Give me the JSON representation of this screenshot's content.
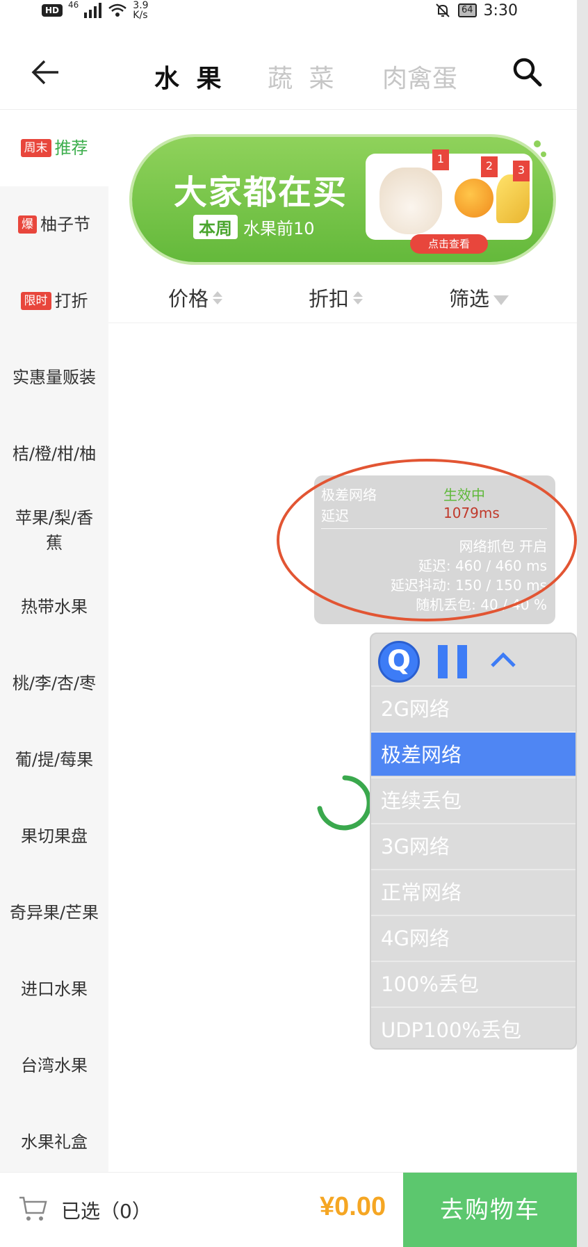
{
  "status_bar": {
    "hd_badge": "HD",
    "network": "46",
    "speed_value": "3.9",
    "speed_unit": "K/s",
    "battery": "64",
    "time": "3:30"
  },
  "header": {
    "tabs": [
      {
        "label": "水 果",
        "active": true
      },
      {
        "label": "蔬 菜",
        "active": false
      },
      {
        "label": "肉禽蛋",
        "active": false
      }
    ]
  },
  "sidebar": {
    "items": [
      {
        "tag": "周末",
        "label": "推荐"
      },
      {
        "tag": "爆",
        "label": "柚子节"
      },
      {
        "tag": "限时",
        "label": "打折"
      },
      {
        "label": "实惠量贩装"
      },
      {
        "label": "桔/橙/柑/柚"
      },
      {
        "label": "苹果/梨/香蕉"
      },
      {
        "label": "热带水果"
      },
      {
        "label": "桃/李/杏/枣"
      },
      {
        "label": "葡/提/莓果"
      },
      {
        "label": "果切果盘"
      },
      {
        "label": "奇异果/芒果"
      },
      {
        "label": "进口水果"
      },
      {
        "label": "台湾水果"
      },
      {
        "label": "水果礼盒"
      }
    ]
  },
  "banner": {
    "title": "大家都在买",
    "badge": "本周",
    "subtitle": "水果前10",
    "ranks": [
      "1",
      "2",
      "3"
    ],
    "button": "点击查看"
  },
  "sort_bar": {
    "price": "价格",
    "discount": "折扣",
    "filter": "筛选"
  },
  "network_panel": {
    "mode_label": "极差网络",
    "mode_status": "生效中",
    "latency_label": "延迟",
    "latency_value": "1079ms",
    "capture": "网络抓包 开启",
    "delay": "延迟: 460 / 460 ms",
    "jitter": "延迟抖动: 150 / 150 ms",
    "loss": "随机丢包: 40 / 40 %",
    "colors": {
      "active": "#5fb83b",
      "latency": "#c0392b"
    }
  },
  "network_menu": {
    "q_label": "Q",
    "items": [
      "2G网络",
      "极差网络",
      "连续丢包",
      "3G网络",
      "正常网络",
      "4G网络",
      "100%丢包",
      "UDP100%丢包"
    ],
    "selected": "极差网络"
  },
  "bottom_bar": {
    "selected_label": "已选（0）",
    "price": "¥0.00",
    "checkout": "去购物车"
  }
}
